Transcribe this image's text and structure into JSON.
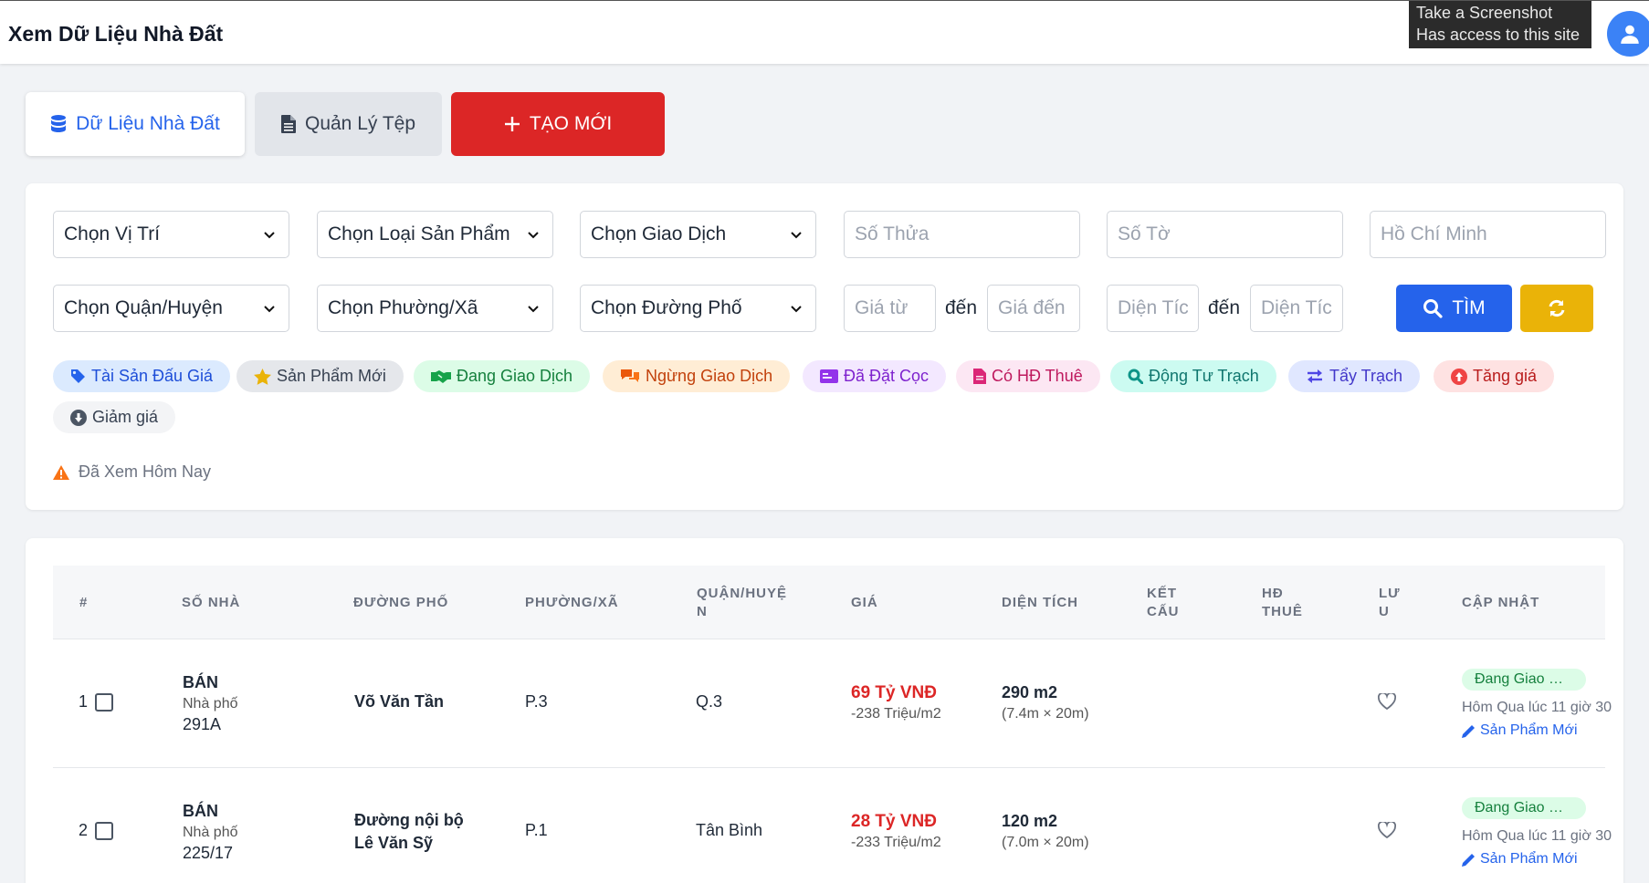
{
  "header": {
    "title": "Xem Dữ Liệu Nhà Đất",
    "tooltip_line1": "Take a Screenshot",
    "tooltip_line2": "Has access to this site"
  },
  "tabs": {
    "data_label": "Dữ Liệu Nhà Đất",
    "files_label": "Quản Lý Tệp",
    "new_label": "TẠO MỚI"
  },
  "filters": {
    "location": "Chọn Vị Trí",
    "product_type": "Chọn Loại Sản Phẩm",
    "transaction": "Chọn Giao Dịch",
    "parcel_placeholder": "Số Thửa",
    "sheet_placeholder": "Số Tờ",
    "city_placeholder": "Hồ Chí Minh",
    "district": "Chọn Quận/Huyện",
    "ward": "Chọn Phường/Xã",
    "street": "Chọn Đường Phố",
    "price_from_placeholder": "Giá từ",
    "to_label": "đến",
    "price_to_placeholder": "Giá đến",
    "area_from_placeholder": "Diện Tíc",
    "area_to_placeholder": "Diện Tíc",
    "search_label": "TÌM"
  },
  "tags": [
    {
      "label": "Tài Sản Đấu Giá",
      "bg": "#dbeafe",
      "color": "#1d4ed8"
    },
    {
      "label": "Sản Phẩm Mới",
      "bg": "#e5e7eb",
      "color": "#374151"
    },
    {
      "label": "Đang Giao Dịch",
      "bg": "#dcfce7",
      "color": "#15803d"
    },
    {
      "label": "Ngừng Giao Dịch",
      "bg": "#ffedd5",
      "color": "#c2410c"
    },
    {
      "label": "Đã Đặt Cọc",
      "bg": "#f3e8ff",
      "color": "#7e22ce"
    },
    {
      "label": "Có HĐ Thuê",
      "bg": "#fce7f3",
      "color": "#be185d"
    },
    {
      "label": "Động Tư Trạch",
      "bg": "#ccfbf1",
      "color": "#0f766e"
    },
    {
      "label": "Tẩy Trạch",
      "bg": "#e0e7ff",
      "color": "#4338ca"
    },
    {
      "label": "Tăng giá",
      "bg": "#fee2e2",
      "color": "#b91c1c"
    },
    {
      "label": "Giảm giá",
      "bg": "#f3f4f6",
      "color": "#374151"
    }
  ],
  "legend": {
    "viewed_today": "Đã Xem Hôm Nay"
  },
  "table": {
    "headers": {
      "index": "#",
      "house_no": "SỐ NHÀ",
      "street": "ĐƯỜNG PHỐ",
      "ward": "PHƯỜNG/XÃ",
      "district_l1": "QUẬN/HUYỆ",
      "district_l2": "N",
      "price": "GIÁ",
      "area": "DIỆN TÍCH",
      "structure_l1": "KẾT",
      "structure_l2": "CẤU",
      "lease_l1": "HĐ",
      "lease_l2": "THUÊ",
      "save_l1": "LƯ",
      "save_l2": "U",
      "updated": "CẬP NHẬT"
    },
    "rows": [
      {
        "index": "1",
        "type": "BÁN",
        "kind": "Nhà phố",
        "house_no": "291A",
        "street_l1": "Võ Văn Tần",
        "street_l2": "",
        "ward": "P.3",
        "district": "Q.3",
        "price": "69 Tỷ VNĐ",
        "unit_price": "-238 Triệu/m2",
        "area": "290 m2",
        "dims": "(7.4m × 20m)",
        "status": "Đang Giao Dịch",
        "updated": "Hôm Qua lúc 11 giờ 30",
        "edit_label": "Sản Phẩm Mới"
      },
      {
        "index": "2",
        "type": "BÁN",
        "kind": "Nhà phố",
        "house_no": "225/17",
        "street_l1": "Đường nội bộ",
        "street_l2": "Lê Văn Sỹ",
        "ward": "P.1",
        "district": "Tân Bình",
        "price": "28 Tỷ VNĐ",
        "unit_price": "-233 Triệu/m2",
        "area": "120 m2",
        "dims": "(7.0m × 20m)",
        "status": "Đang Giao Dịch",
        "updated": "Hôm Qua lúc 11 giờ 30",
        "edit_label": "Sản Phẩm Mới"
      }
    ]
  }
}
